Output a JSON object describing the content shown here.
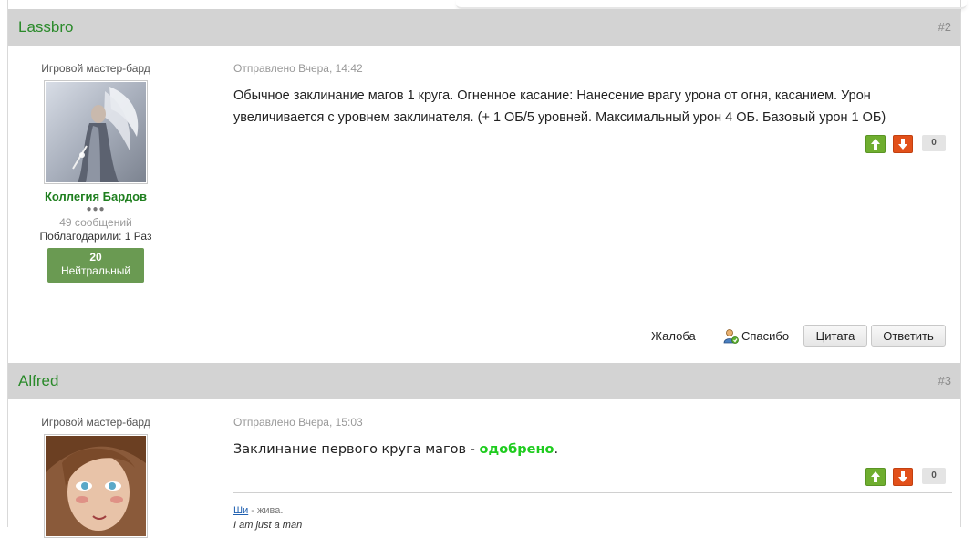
{
  "posts": [
    {
      "author": "Lassbro",
      "number": "#2",
      "author_title": "Игровой мастер-бард",
      "group": "Коллегия Бардов",
      "pips": "●●●",
      "post_count": "49 сообщений",
      "thanks": "Поблагодарили: 1 Раз",
      "rep_value": "20",
      "rep_label": "Нейтральный",
      "meta": "Отправлено Вчера, 14:42",
      "body_line1": "Обычное заклинание магов 1 круга. Огненное касание: Нанесение врагу урона от огня, касанием. Урон",
      "body_line2": "увеличивается с уровнем заклинателя. (+ 1 ОБ/5 уровней. Максимальный урон 4 ОБ. Базовый урон 1 ОБ)",
      "vote_count": "0",
      "actions": {
        "report": "Жалоба",
        "thanks": "Спасибо",
        "quote": "Цитата",
        "reply": "Ответить"
      }
    },
    {
      "author": "Alfred",
      "number": "#3",
      "author_title": "Игровой мастер-бард",
      "meta": "Отправлено Вчера, 15:03",
      "body_prefix": "Заклинание первого круга магов - ",
      "body_approved": "одобрено",
      "body_suffix": ".",
      "vote_count": "0",
      "signature": {
        "link": "Ши",
        "rest": " - жива.",
        "line2": "I am just a man"
      }
    }
  ],
  "colors": {
    "header_bg": "#d3d3d3",
    "author_name": "#2a8a2a",
    "approved": "#1fcc1f",
    "rep_bg": "#6a9a52",
    "vote_up": "#6fae2f",
    "vote_down": "#e2501a"
  },
  "icons": [
    "arrow-up-icon",
    "arrow-down-icon",
    "thanks-user-icon"
  ]
}
